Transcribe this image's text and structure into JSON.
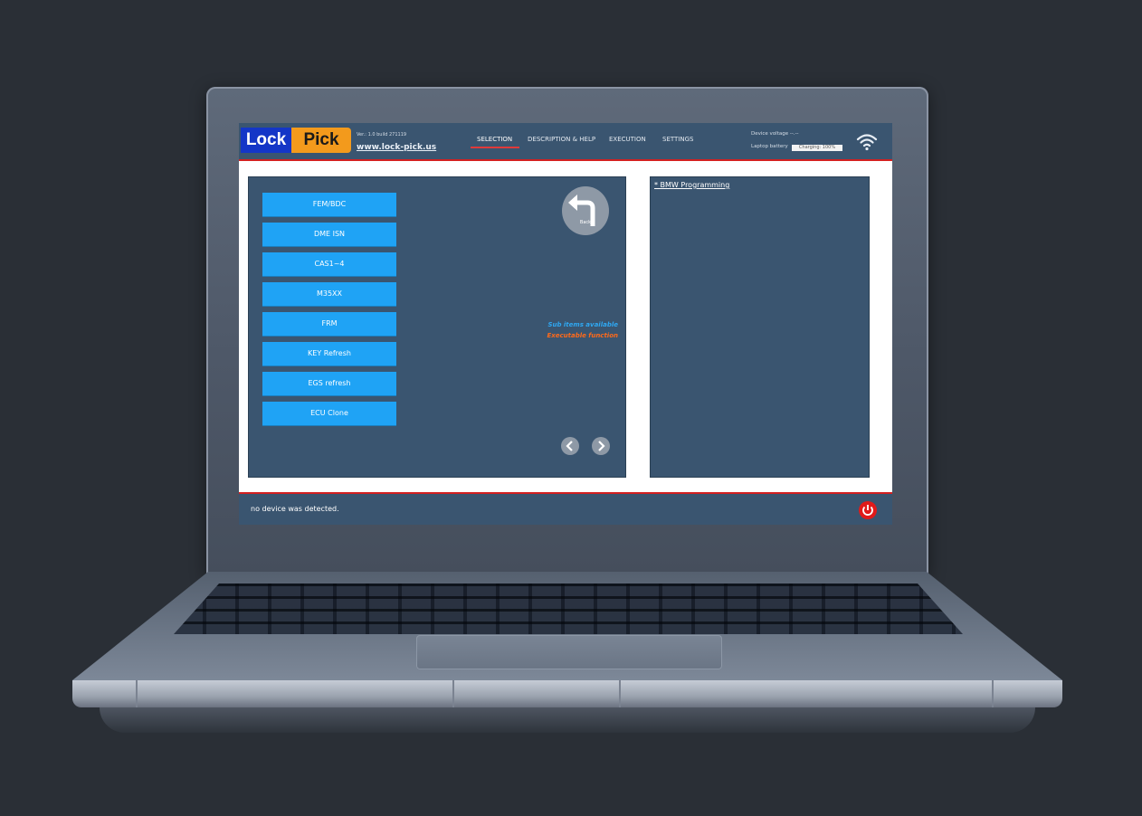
{
  "app": {
    "logo_text_a": "Lock",
    "logo_text_b": "Pick",
    "version": "Ver.: 1.0 build 271119",
    "website": "www.lock-pick.us"
  },
  "nav": {
    "tabs": [
      {
        "label": "SELECTION",
        "active": true
      },
      {
        "label": "DESCRIPTION & HELP",
        "active": false
      },
      {
        "label": "EXECUTION",
        "active": false
      },
      {
        "label": "SETTINGS",
        "active": false
      }
    ]
  },
  "status_info": {
    "device_voltage": "Device voltage --.--",
    "laptop_battery_label": "Laptop battery",
    "battery_value": "Charging: 100%"
  },
  "menu": {
    "items": [
      "FEM/BDC",
      "DME ISN",
      "CAS1~4",
      "M35XX",
      "FRM",
      "KEY Refresh",
      "EGS refresh",
      "ECU Clone"
    ],
    "back_label": "Back",
    "legend_sub": "Sub items available",
    "legend_exec": "Executable function"
  },
  "path": {
    "breadcrumb": "* BMW Programming"
  },
  "statusbar": {
    "message": "no device was detected."
  },
  "colors": {
    "header_bg": "#3a5570",
    "button": "#1fa3f5",
    "accent_red": "#d32020",
    "logo_blue": "#1436c7",
    "logo_orange": "#f39a1c"
  },
  "icons": [
    "wifi-icon",
    "back-arrow-icon",
    "chevron-left-icon",
    "chevron-right-icon",
    "power-icon"
  ]
}
